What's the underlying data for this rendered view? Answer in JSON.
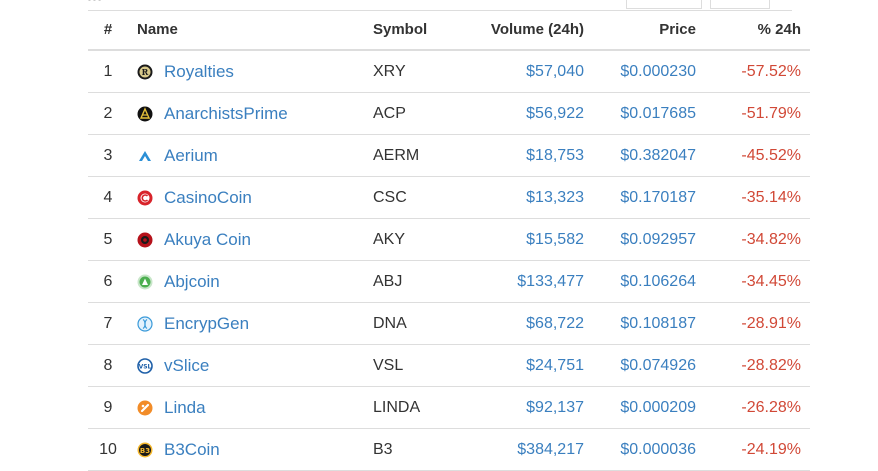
{
  "table": {
    "headers": {
      "num": "#",
      "name": "Name",
      "symbol": "Symbol",
      "volume": "Volume (24h)",
      "price": "Price",
      "change": "% 24h"
    },
    "rows": [
      {
        "rank": "1",
        "name": "Royalties",
        "symbol": "XRY",
        "volume": "$57,040",
        "price": "$0.000230",
        "change": "-57.52%",
        "icon": "royalties-icon"
      },
      {
        "rank": "2",
        "name": "AnarchistsPrime",
        "symbol": "ACP",
        "volume": "$56,922",
        "price": "$0.017685",
        "change": "-51.79%",
        "icon": "anarchistsprime-icon"
      },
      {
        "rank": "3",
        "name": "Aerium",
        "symbol": "AERM",
        "volume": "$18,753",
        "price": "$0.382047",
        "change": "-45.52%",
        "icon": "aerium-icon"
      },
      {
        "rank": "4",
        "name": "CasinoCoin",
        "symbol": "CSC",
        "volume": "$13,323",
        "price": "$0.170187",
        "change": "-35.14%",
        "icon": "casinocoin-icon"
      },
      {
        "rank": "5",
        "name": "Akuya Coin",
        "symbol": "AKY",
        "volume": "$15,582",
        "price": "$0.092957",
        "change": "-34.82%",
        "icon": "akuya-coin-icon"
      },
      {
        "rank": "6",
        "name": "Abjcoin",
        "symbol": "ABJ",
        "volume": "$133,477",
        "price": "$0.106264",
        "change": "-34.45%",
        "icon": "abjcoin-icon"
      },
      {
        "rank": "7",
        "name": "EncrypGen",
        "symbol": "DNA",
        "volume": "$68,722",
        "price": "$0.108187",
        "change": "-28.91%",
        "icon": "encrypgen-icon"
      },
      {
        "rank": "8",
        "name": "vSlice",
        "symbol": "VSL",
        "volume": "$24,751",
        "price": "$0.074926",
        "change": "-28.82%",
        "icon": "vslice-icon"
      },
      {
        "rank": "9",
        "name": "Linda",
        "symbol": "LINDA",
        "volume": "$92,137",
        "price": "$0.000209",
        "change": "-26.28%",
        "icon": "linda-icon"
      },
      {
        "rank": "10",
        "name": "B3Coin",
        "symbol": "B3",
        "volume": "$384,217",
        "price": "$0.000036",
        "change": "-24.19%",
        "icon": "b3coin-icon"
      }
    ]
  },
  "colors": {
    "link": "#3a7fbf",
    "negative": "#d14836",
    "text": "#333333",
    "border": "#dddddd"
  }
}
